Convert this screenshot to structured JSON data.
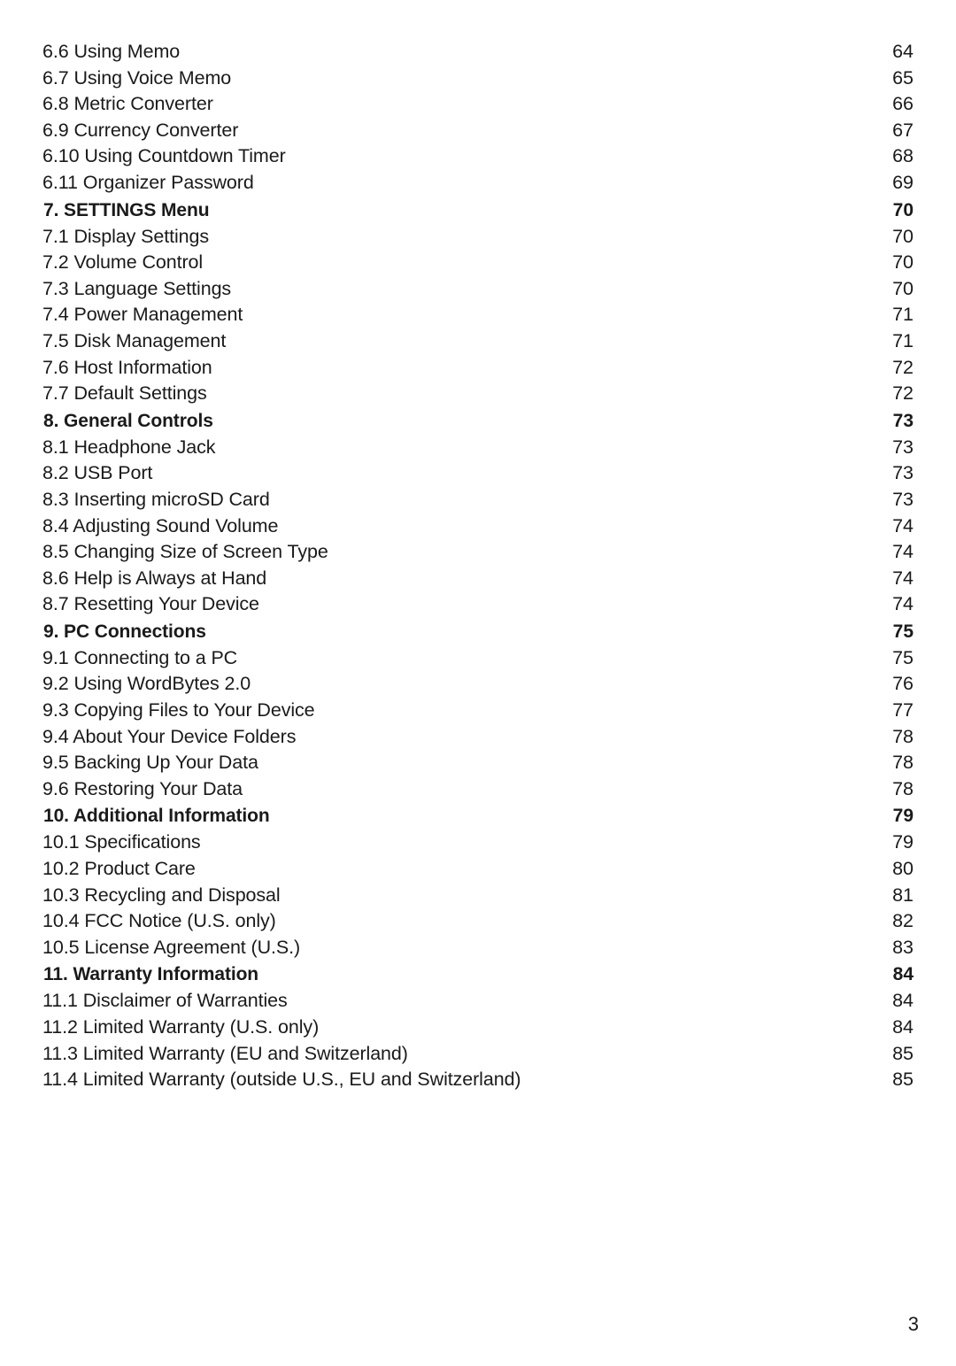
{
  "document": {
    "folio": "3",
    "toc_entries": [
      {
        "label": "6.6 Using Memo",
        "page": "64",
        "heading": false
      },
      {
        "label": "6.7 Using Voice Memo",
        "page": "65",
        "heading": false
      },
      {
        "label": "6.8 Metric Converter",
        "page": "66",
        "heading": false
      },
      {
        "label": "6.9 Currency Converter",
        "page": "67",
        "heading": false
      },
      {
        "label": "6.10 Using Countdown Timer",
        "page": "68",
        "heading": false
      },
      {
        "label": "6.11 Organizer Password",
        "page": "69",
        "heading": false
      },
      {
        "label": "7. SETTINGS Menu",
        "page": "70",
        "heading": true
      },
      {
        "label": "7.1 Display Settings",
        "page": "70",
        "heading": false
      },
      {
        "label": "7.2 Volume Control",
        "page": "70",
        "heading": false
      },
      {
        "label": "7.3 Language Settings",
        "page": "70",
        "heading": false
      },
      {
        "label": "7.4 Power Management",
        "page": "71",
        "heading": false
      },
      {
        "label": "7.5 Disk Management",
        "page": "71",
        "heading": false
      },
      {
        "label": "7.6 Host Information",
        "page": "72",
        "heading": false
      },
      {
        "label": "7.7 Default Settings",
        "page": "72",
        "heading": false
      },
      {
        "label": "8. General Controls",
        "page": "73",
        "heading": true
      },
      {
        "label": "8.1 Headphone Jack",
        "page": "73",
        "heading": false
      },
      {
        "label": "8.2 USB Port",
        "page": "73",
        "heading": false
      },
      {
        "label": "8.3 Inserting microSD Card",
        "page": "73",
        "heading": false
      },
      {
        "label": "8.4 Adjusting Sound Volume",
        "page": "74",
        "heading": false
      },
      {
        "label": "8.5 Changing Size of Screen Type",
        "page": "74",
        "heading": false
      },
      {
        "label": "8.6 Help is Always at Hand",
        "page": "74",
        "heading": false
      },
      {
        "label": "8.7 Resetting Your Device",
        "page": "74",
        "heading": false
      },
      {
        "label": "9. PC Connections",
        "page": "75",
        "heading": true
      },
      {
        "label": "9.1 Connecting to a PC",
        "page": "75",
        "heading": false
      },
      {
        "label": "9.2 Using WordBytes 2.0",
        "page": "76",
        "heading": false
      },
      {
        "label": "9.3 Copying Files to Your Device",
        "page": "77",
        "heading": false
      },
      {
        "label": "9.4 About Your Device Folders",
        "page": "78",
        "heading": false
      },
      {
        "label": "9.5 Backing Up Your Data",
        "page": "78",
        "heading": false
      },
      {
        "label": "9.6 Restoring Your Data",
        "page": "78",
        "heading": false
      },
      {
        "label": "10. Additional Information",
        "page": "79",
        "heading": true
      },
      {
        "label": "10.1 Specifications",
        "page": "79",
        "heading": false
      },
      {
        "label": "10.2 Product Care",
        "page": "80",
        "heading": false
      },
      {
        "label": "10.3 Recycling and Disposal",
        "page": "81",
        "heading": false
      },
      {
        "label": "10.4 FCC Notice (U.S. only)",
        "page": "82",
        "heading": false
      },
      {
        "label": "10.5 License Agreement (U.S.)",
        "page": "83",
        "heading": false
      },
      {
        "label": "11. Warranty Information",
        "page": "84",
        "heading": true
      },
      {
        "label": "11.1 Disclaimer of Warranties",
        "page": "84",
        "heading": false
      },
      {
        "label": "11.2 Limited Warranty (U.S. only)",
        "page": "84",
        "heading": false
      },
      {
        "label": "11.3 Limited Warranty (EU and Switzerland)",
        "page": "85",
        "heading": false
      },
      {
        "label": "11.4 Limited Warranty (outside U.S., EU and Switzerland)",
        "page": "85",
        "heading": false
      }
    ]
  }
}
